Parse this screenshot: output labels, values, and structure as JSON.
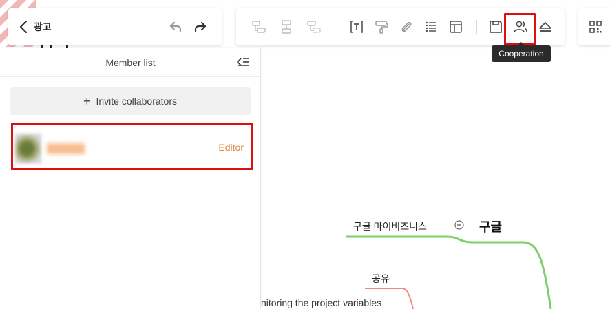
{
  "header": {
    "title": "광고",
    "icons": {
      "back": "chevron-left-icon",
      "undo": "undo-icon",
      "redo": "redo-icon"
    }
  },
  "toolbar": {
    "icons": [
      "insert-child-topic-icon",
      "insert-sibling-topic-icon",
      "insert-parent-topic-icon",
      "text-box-icon",
      "format-painter-icon",
      "attachment-icon",
      "list-icon",
      "layout-icon",
      "save-icon",
      "cooperation-icon",
      "eject-icon"
    ],
    "tooltip": "Cooperation",
    "qr_icon": "qr-code-icon",
    "highlight_color": "#dd1010"
  },
  "member_panel": {
    "title": "Member list",
    "invite_label": "Invite collaborators",
    "members": [
      {
        "role": "Editor"
      }
    ]
  },
  "mind_map": {
    "central_topic": "구글",
    "topics": [
      "구글 마이비즈니스",
      "공유",
      "nitoring the project variables"
    ],
    "colors": {
      "green_branch": "#7ecf6a",
      "red_branch": "#ec8a80",
      "accent_orange": "#e0883c"
    }
  }
}
